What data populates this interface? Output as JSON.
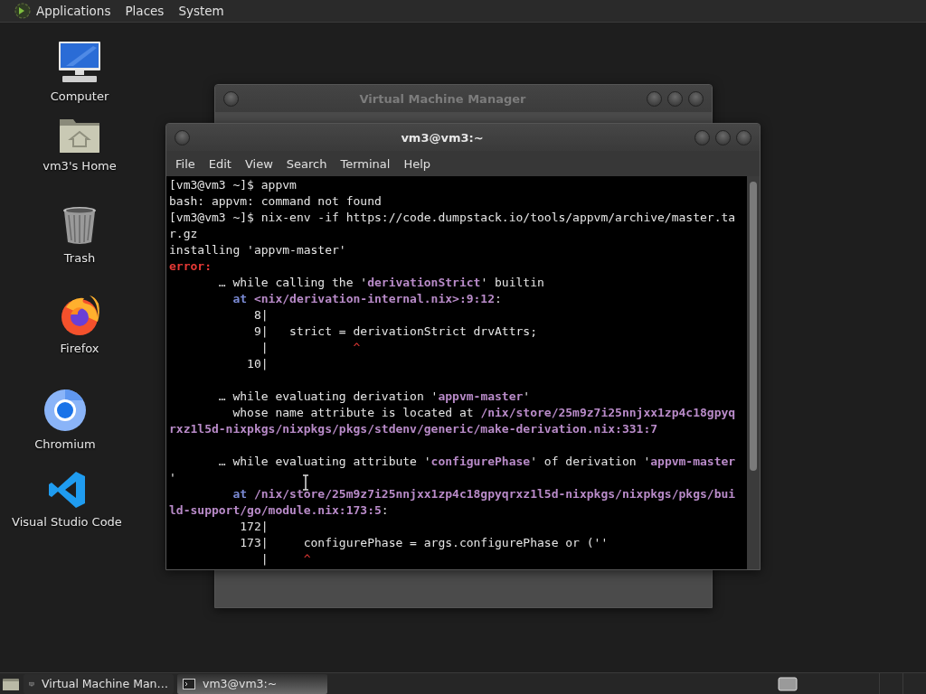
{
  "top_panel": {
    "menus": [
      "Applications",
      "Places",
      "System"
    ]
  },
  "desktop_icons": [
    {
      "label": "Computer",
      "kind": "computer"
    },
    {
      "label": "vm3's Home",
      "kind": "home"
    },
    {
      "label": "Trash",
      "kind": "trash"
    },
    {
      "label": "Firefox",
      "kind": "firefox"
    },
    {
      "label": "Chromium",
      "kind": "chromium"
    },
    {
      "label": "Visual Studio Code",
      "kind": "vscode"
    }
  ],
  "windows": [
    {
      "kind": "manager",
      "title": "Virtual Machine Manager",
      "active": false
    },
    {
      "kind": "terminal",
      "title": "vm3@vm3:~",
      "active": true,
      "menu": [
        "File",
        "Edit",
        "View",
        "Search",
        "Terminal",
        "Help"
      ],
      "lines": [
        {
          "text": "[vm3@vm3 ~]$ appvm"
        },
        {
          "text": "bash: appvm: command not found"
        },
        {
          "text": "[vm3@vm3 ~]$ nix-env -if https://code.dumpstack.io/tools/appvm/archive/master.ta"
        },
        {
          "text": "r.gz"
        },
        {
          "text": "installing 'appvm-master'"
        },
        {
          "parts": [
            {
              "text": "error:",
              "kind": "error"
            }
          ]
        },
        {
          "parts": [
            {
              "text": "       … while calling the '",
              "kind": "plain"
            },
            {
              "text": "derivationStrict",
              "kind": "highlight"
            },
            {
              "text": "' builtin",
              "kind": "plain"
            }
          ]
        },
        {
          "parts": [
            {
              "text": "         at",
              "kind": "keyword"
            },
            {
              "text": " <nix/derivation-internal.nix>:9:12",
              "kind": "highlight"
            },
            {
              "text": ":",
              "kind": "plain"
            }
          ]
        },
        {
          "text": "            8|"
        },
        {
          "text": "            9|   strict = derivationStrict drvAttrs;"
        },
        {
          "parts": [
            {
              "text": "             |            ",
              "kind": "plain"
            },
            {
              "text": "^",
              "kind": "marker"
            }
          ]
        },
        {
          "text": "           10|"
        },
        {
          "space_before": true,
          "parts": [
            {
              "text": "       … while evaluating derivation '",
              "kind": "plain"
            },
            {
              "text": "appvm-master",
              "kind": "highlight"
            },
            {
              "text": "'",
              "kind": "plain"
            }
          ]
        },
        {
          "parts": [
            {
              "text": "         whose name attribute is located at ",
              "kind": "plain"
            },
            {
              "text": "/nix/store/25m9z7i25nnjxx1zp4c18gpyq",
              "kind": "highlight"
            }
          ]
        },
        {
          "parts": [
            {
              "text": "rxz1l5d-nixpkgs/nixpkgs/pkgs/stdenv/generic/make-derivation.nix:331:7",
              "kind": "highlight"
            }
          ]
        },
        {
          "space_before": true,
          "parts": [
            {
              "text": "       … while evaluating attribute '",
              "kind": "plain"
            },
            {
              "text": "configurePhase",
              "kind": "highlight"
            },
            {
              "text": "' of derivation '",
              "kind": "plain"
            },
            {
              "text": "appvm-master",
              "kind": "highlight"
            }
          ]
        },
        {
          "text": "'"
        },
        {
          "parts": [
            {
              "text": "         at",
              "kind": "keyword"
            },
            {
              "text": " /nix/store/25m9z7i25nnjxx1zp4c18gpyqrxz1l5d-nixpkgs/nixpkgs/pkgs/bui",
              "kind": "highlight"
            }
          ]
        },
        {
          "parts": [
            {
              "text": "ld-support/go/module.nix:173:5",
              "kind": "highlight"
            },
            {
              "text": ":",
              "kind": "plain"
            }
          ]
        },
        {
          "text": "          172|"
        },
        {
          "text": "          173|     configurePhase = args.configurePhase or (''"
        },
        {
          "parts": [
            {
              "text": "             |     ",
              "kind": "plain"
            },
            {
              "text": "^",
              "kind": "marker"
            }
          ]
        }
      ]
    }
  ],
  "taskbar": {
    "tasks": [
      {
        "label": "Virtual Machine Man…",
        "kind": "manager",
        "selected": false
      },
      {
        "label": "vm3@vm3:~",
        "kind": "terminal",
        "selected": true
      }
    ]
  }
}
